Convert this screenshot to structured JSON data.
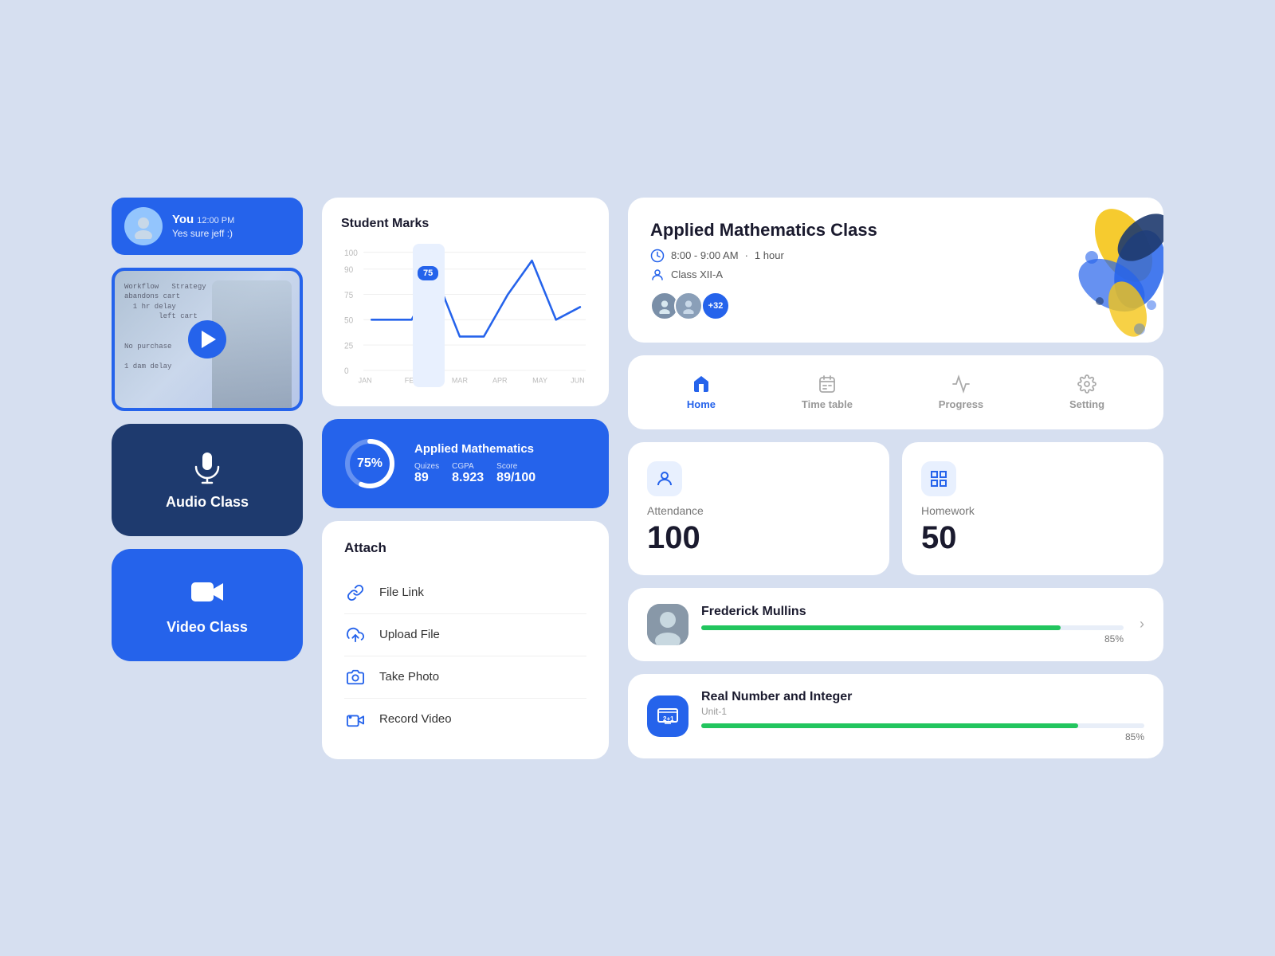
{
  "chat": {
    "name": "You",
    "time": "12:00 PM",
    "message": "Yes sure jeff :)"
  },
  "nav": {
    "tabs": [
      {
        "id": "home",
        "label": "Home",
        "active": true
      },
      {
        "id": "timetable",
        "label": "Time table",
        "active": false
      },
      {
        "id": "progress",
        "label": "Progress",
        "active": false
      },
      {
        "id": "setting",
        "label": "Setting",
        "active": false
      }
    ]
  },
  "class": {
    "title": "Applied Mathematics Class",
    "time": "8:00 - 9:00 AM",
    "duration": "1 hour",
    "class": "Class XII-A",
    "student_count": "+32"
  },
  "audio_class": {
    "label": "Audio Class"
  },
  "video_class": {
    "label": "Video Class"
  },
  "chart": {
    "title": "Student Marks",
    "highlight_value": "75",
    "x_labels": [
      "JAN",
      "FEB",
      "MAR",
      "APR",
      "MAY",
      "JUN"
    ],
    "y_labels": [
      "100",
      "90",
      "75",
      "50",
      "25",
      "0"
    ]
  },
  "stats": {
    "subject": "Applied Mathematics",
    "percentage": "75%",
    "quizes_label": "Quizes",
    "quizes_value": "89",
    "cgpa_label": "CGPA",
    "cgpa_value": "8.923",
    "score_label": "Score",
    "score_value": "89/100"
  },
  "attach": {
    "title": "Attach",
    "items": [
      {
        "label": "File Link",
        "icon": "link-icon"
      },
      {
        "label": "Upload File",
        "icon": "upload-icon"
      },
      {
        "label": "Take Photo",
        "icon": "camera-icon"
      },
      {
        "label": "Record Video",
        "icon": "video-icon"
      }
    ]
  },
  "attendance": {
    "label": "Attendance",
    "value": "100"
  },
  "homework": {
    "label": "Homework",
    "value": "50"
  },
  "students": [
    {
      "name": "Frederick Mullins",
      "progress": 85,
      "pct": "85%"
    }
  ],
  "subject_card": {
    "name": "Real Number and Integer",
    "unit": "Unit-1",
    "progress": 85,
    "pct": "85%"
  }
}
